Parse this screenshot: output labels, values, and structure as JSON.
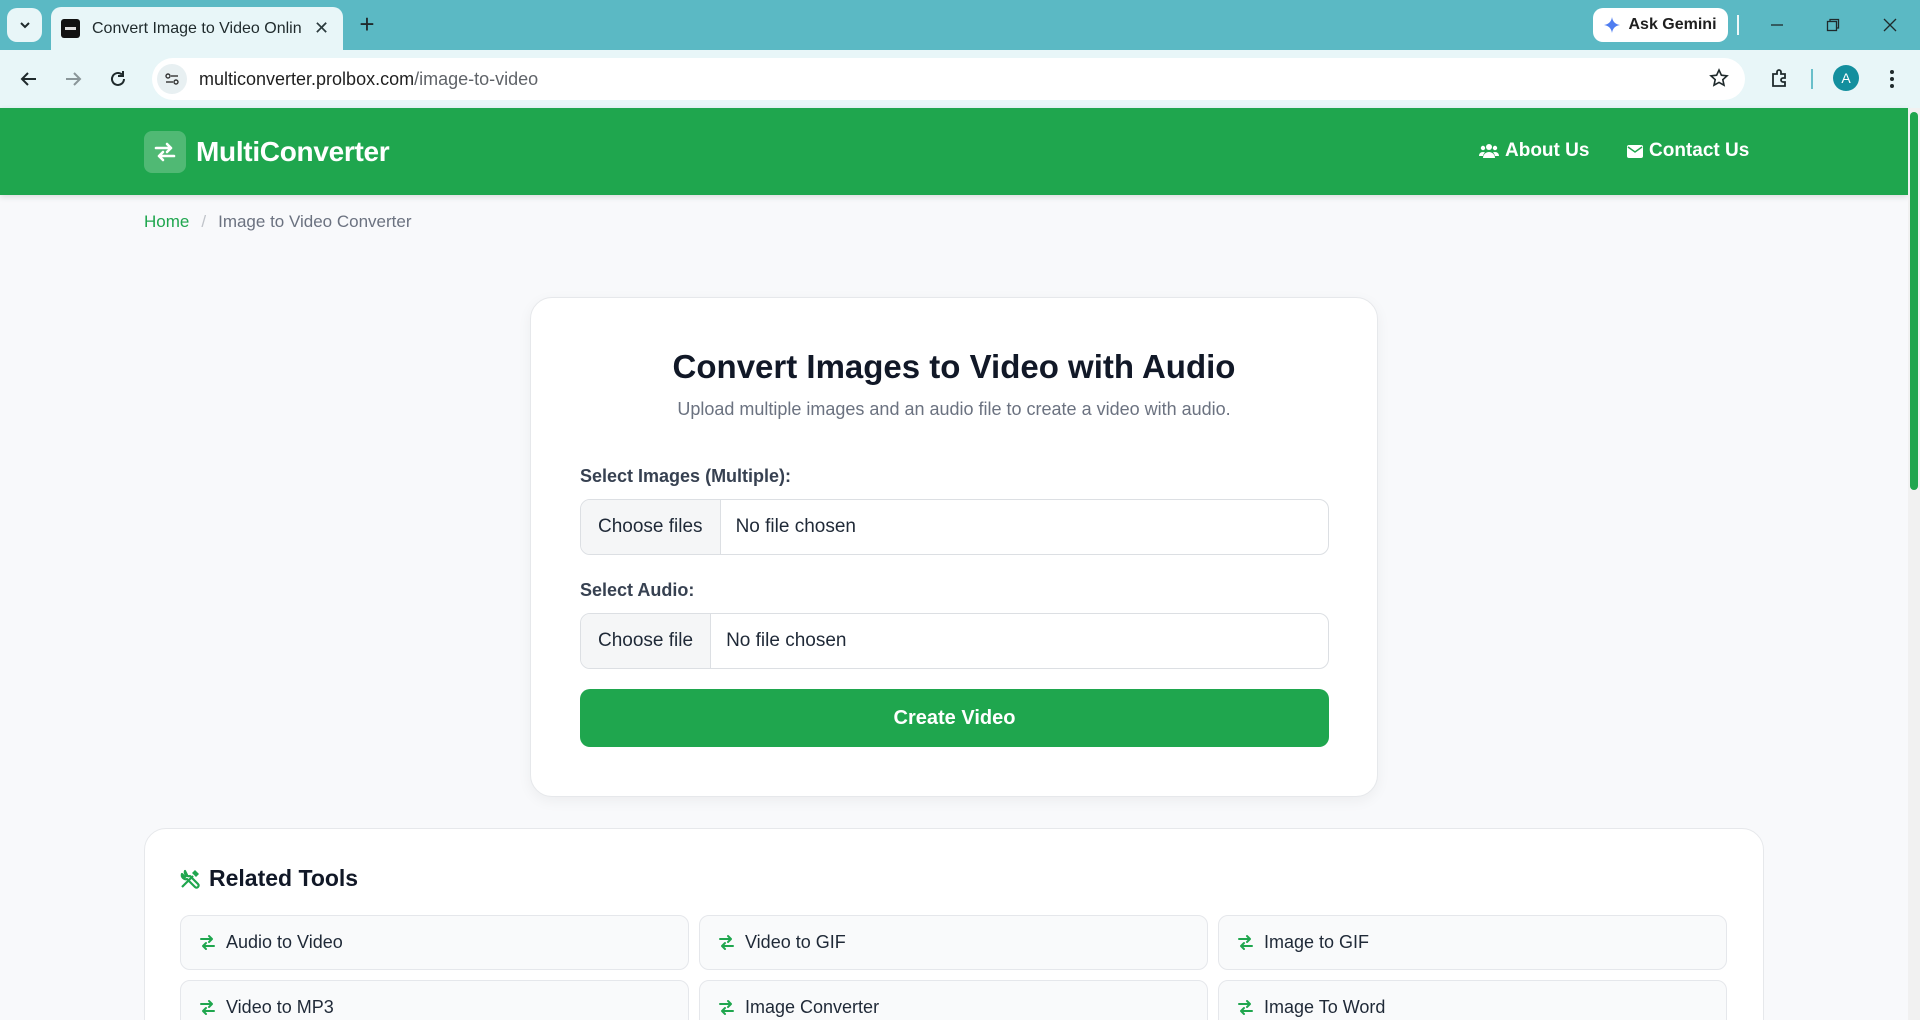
{
  "browser": {
    "tab_title": "Convert Image to Video Online",
    "gemini_label": "Ask Gemini",
    "url_host": "multiconverter.prolbox.com",
    "url_path": "/image-to-video",
    "avatar_letter": "A"
  },
  "header": {
    "logo_text": "MultiConverter",
    "about_label": "About Us",
    "contact_label": "Contact Us",
    "brand_color": "#1fa64e"
  },
  "breadcrumb": {
    "home": "Home",
    "separator": "/",
    "current": "Image to Video Converter"
  },
  "converter": {
    "title": "Convert Images to Video with Audio",
    "subtitle": "Upload multiple images and an audio file to create a video with audio.",
    "images_label": "Select Images (Multiple):",
    "images_button": "Choose files",
    "images_status": "No file chosen",
    "audio_label": "Select Audio:",
    "audio_button": "Choose file",
    "audio_status": "No file chosen",
    "create_button": "Create Video"
  },
  "related": {
    "title": "Related Tools",
    "tools": [
      "Audio to Video",
      "Video to GIF",
      "Image to GIF",
      "Video to MP3",
      "Image Converter",
      "Image To Word"
    ]
  }
}
